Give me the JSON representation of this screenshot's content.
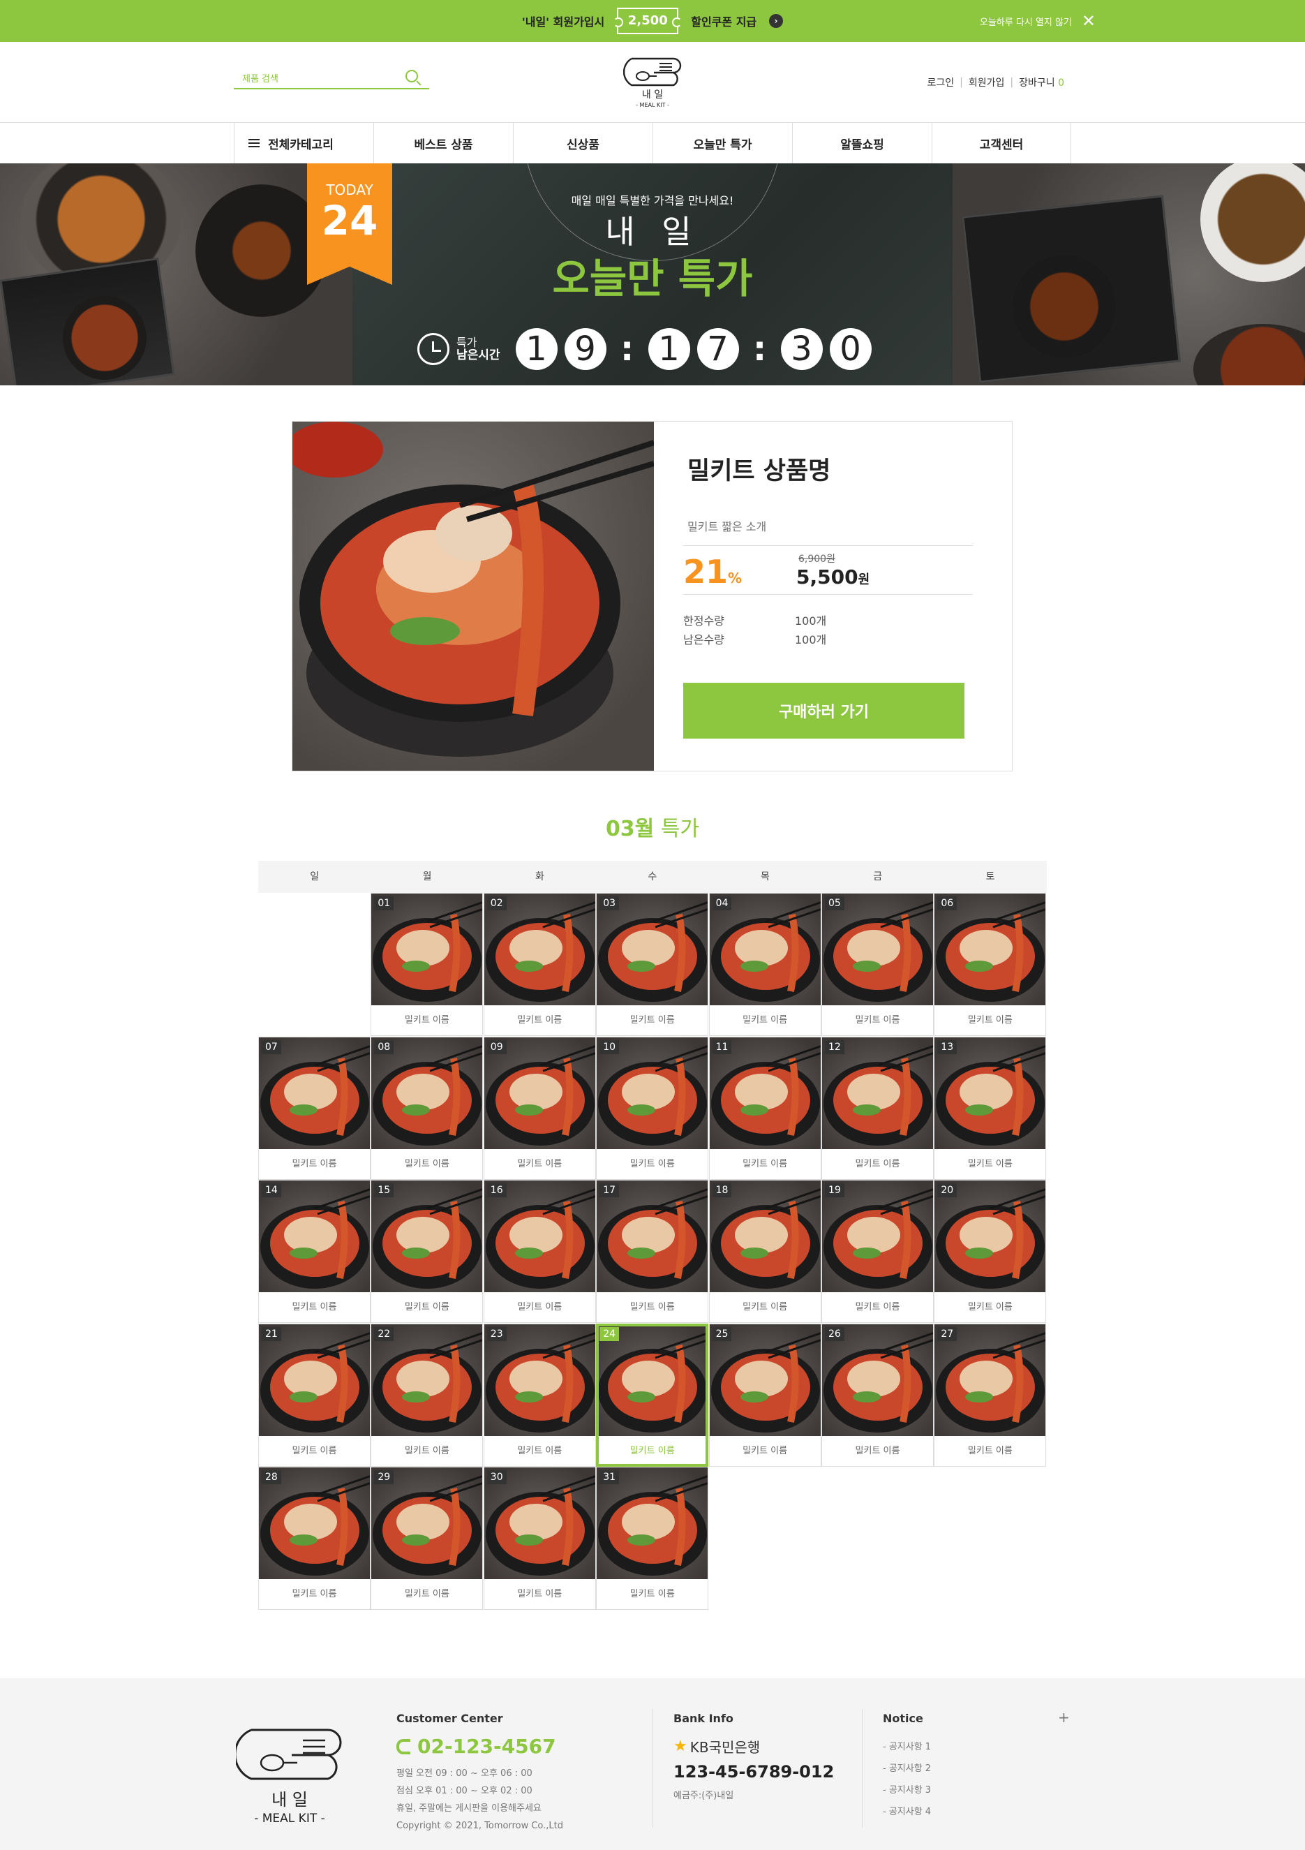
{
  "topbar": {
    "promo_left": "'내일' 회원가입시",
    "coupon_value": "2,500",
    "promo_right": "할인쿠폰 지급",
    "close_text": "오늘하루 다시 열지 않기"
  },
  "header": {
    "search_placeholder": "제품 검색",
    "logo_text": "내    일",
    "logo_sub": "- MEAL KIT -",
    "util": {
      "login": "로그인",
      "join": "회원가입",
      "cart": "장바구니",
      "cart_count": "0"
    }
  },
  "gnb": [
    "전체카테고리",
    "베스트 상품",
    "신상품",
    "오늘만 특가",
    "알뜰쇼핑",
    "고객센터"
  ],
  "banner": {
    "today_label": "TODAY",
    "today_day": "24",
    "sub": "매일 매일 특별한 가격을 만나세요!",
    "brand": "내 일",
    "headline": "오늘만 특가",
    "timer_label1": "특가",
    "timer_label2": "남은시간",
    "timer_digits": [
      "1",
      "9",
      "1",
      "7",
      "3",
      "0"
    ]
  },
  "deal": {
    "title": "밀키트 상품명",
    "desc": "밀키트 짧은 소개",
    "rate": "21",
    "rate_unit": "%",
    "original_price": "6,900원",
    "price": "5,500",
    "price_unit": "원",
    "limit_label": "한정수량",
    "limit_value": "100개",
    "remain_label": "남은수량",
    "remain_value": "100개",
    "buy_label": "구매하러 가기"
  },
  "calendar": {
    "month": "03월",
    "title_suffix": "특가",
    "weekdays": [
      "일",
      "월",
      "화",
      "수",
      "목",
      "금",
      "토"
    ],
    "item_name": "밀키트 이름",
    "first_weekday": 1,
    "days": 31,
    "selected_day": 24
  },
  "footer": {
    "logo_text": "내    일",
    "logo_sub": "- MEAL KIT -",
    "cs_title": "Customer Center",
    "cs_phone": "02-123-4567",
    "cs_hours1": "평일 오전 09 : 00 ~ 오후 06 : 00",
    "cs_hours2": "점심 오후 01 : 00 ~ 오후 02 : 00",
    "cs_hours3": "휴일, 주말에는 게시판을 이용해주세요",
    "copyright": "Copyright © 2021, Tomorrow Co.,Ltd",
    "bank_title": "Bank Info",
    "bank_name": "KB국민은행",
    "bank_account": "123-45-6789-012",
    "bank_holder": "예금주:(주)내일",
    "notice_title": "Notice",
    "notices": [
      "- 공지사항 1",
      "- 공지사항 2",
      "- 공지사항 3",
      "- 공지사항 4"
    ]
  },
  "colors": {
    "accent": "#8dc63f",
    "orange": "#f7931e"
  }
}
